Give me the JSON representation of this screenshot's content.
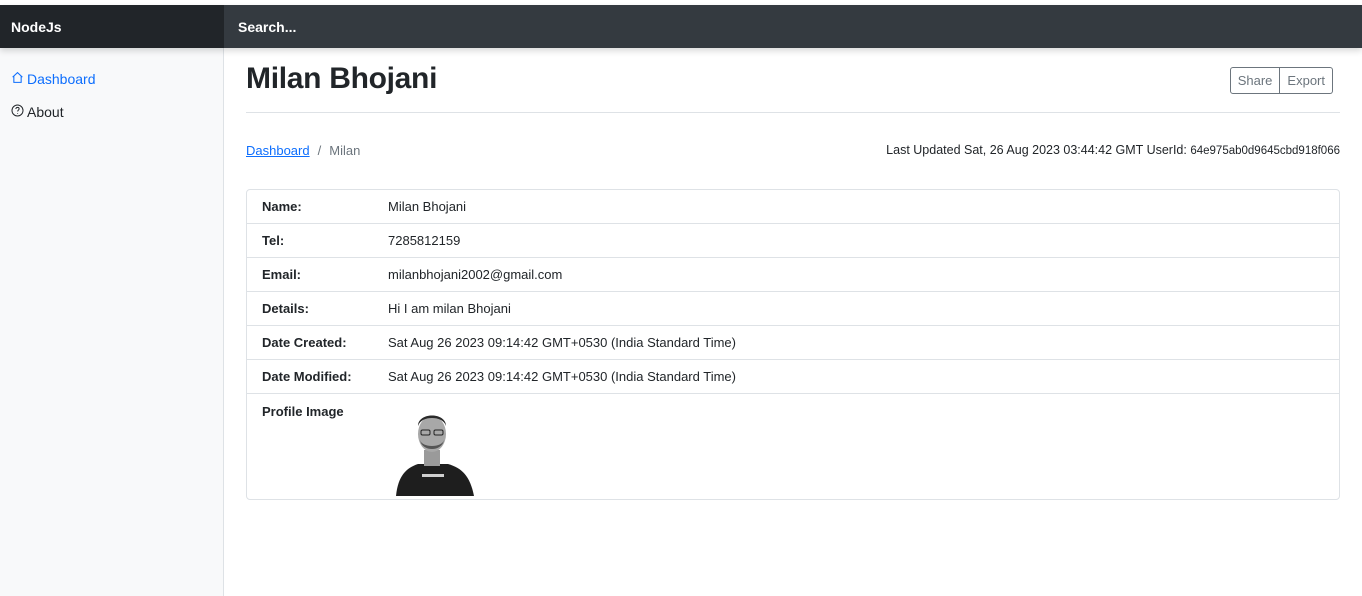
{
  "navbar": {
    "brand": "NodeJs",
    "search_placeholder": "Search..."
  },
  "sidebar": {
    "items": [
      {
        "label": "Dashboard",
        "icon": "house-icon",
        "active": true
      },
      {
        "label": "About",
        "icon": "question-circle-icon",
        "active": false
      }
    ]
  },
  "page": {
    "title": "Milan Bhojani",
    "share_label": "Share",
    "export_label": "Export"
  },
  "breadcrumb": {
    "link": "Dashboard",
    "separator": "/",
    "current": "Milan"
  },
  "meta": {
    "updated_text": "Last Updated Sat, 26 Aug 2023 03:44:42 GMT",
    "userid_label": "UserId:",
    "userid_value": "64e975ab0d9645cbd918f066"
  },
  "details": {
    "rows": [
      {
        "label": "Name:",
        "value": "Milan Bhojani"
      },
      {
        "label": "Tel:",
        "value": "7285812159"
      },
      {
        "label": "Email:",
        "value": "milanbhojani2002@gmail.com"
      },
      {
        "label": "Details:",
        "value": "Hi I am milan Bhojani"
      },
      {
        "label": "Date Created:",
        "value": "Sat Aug 26 2023 09:14:42 GMT+0530 (India Standard Time)"
      },
      {
        "label": "Date Modified:",
        "value": "Sat Aug 26 2023 09:14:42 GMT+0530 (India Standard Time)"
      }
    ],
    "image_label": "Profile Image"
  },
  "colors": {
    "navbar": "#343a40",
    "brand_bg": "#212529",
    "link": "#0d6efd",
    "sidebar_bg": "#f8f9fa"
  }
}
